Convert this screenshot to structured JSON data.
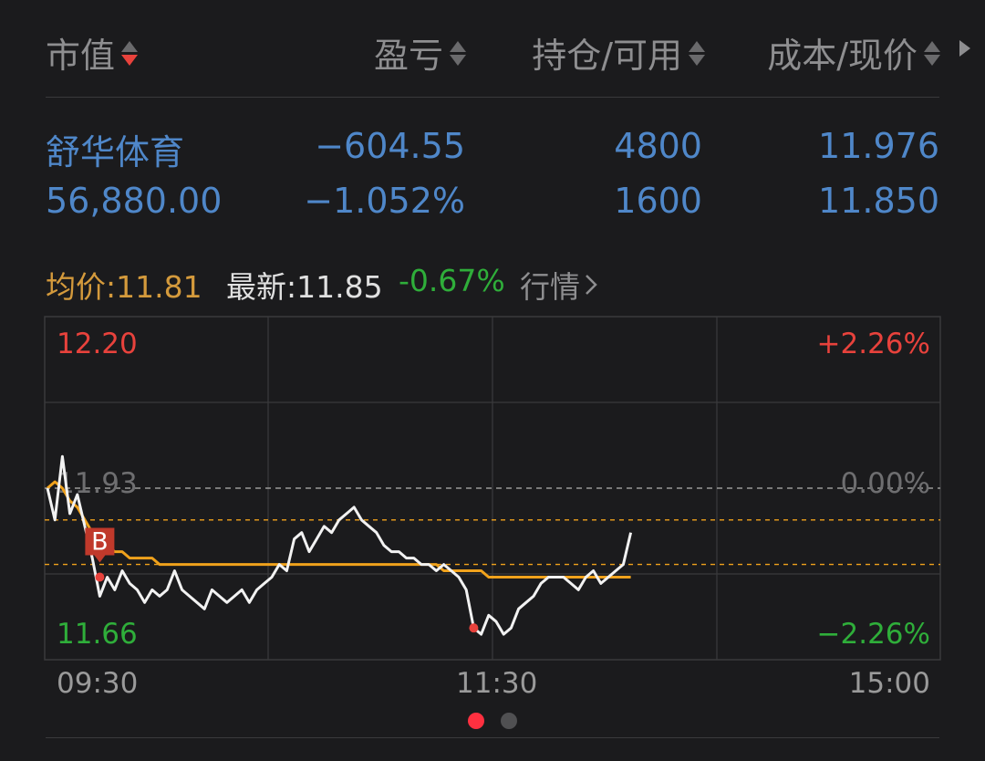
{
  "header": {
    "col1": "市值",
    "col2": "盈亏",
    "col3": "持仓/可用",
    "col4": "成本/现价"
  },
  "position": {
    "name": "舒华体育",
    "market_value": "56,880.00",
    "pnl": "−604.55",
    "pnl_pct": "−1.052%",
    "holding": "4800",
    "available": "1600",
    "cost": "11.976",
    "price": "11.850"
  },
  "quote": {
    "avg_label": "均价:",
    "avg_value": "11.81",
    "latest_label": "最新:",
    "latest_value": "11.85",
    "change_pct": "-0.67%",
    "detail_link": "行情"
  },
  "colors": {
    "blue": "#4f87c9",
    "red": "#e8423c",
    "green": "#2fae3a",
    "orange": "#f0a21c",
    "avg_label": "#d49a3c"
  },
  "chart_data": {
    "type": "line",
    "x_ticks": [
      "09:30",
      "11:30",
      "15:00"
    ],
    "ylim": [
      11.66,
      12.2
    ],
    "y_labels": {
      "top": "12.20",
      "mid": "11.93",
      "bottom": "11.66"
    },
    "pct_labels": {
      "top": "+2.26%",
      "mid": "0.00%",
      "bottom": "−2.26%"
    },
    "prev_close": 11.93,
    "reference_lines": [
      11.88,
      11.81
    ],
    "trade_marker": {
      "label": "B",
      "x_index": 7,
      "price": 11.81
    },
    "red_markers": [
      {
        "x_index": 7,
        "price": 11.79
      },
      {
        "x_index": 57,
        "price": 11.71
      }
    ],
    "series": [
      {
        "key": "price",
        "values": [
          11.93,
          11.88,
          11.98,
          11.89,
          11.92,
          11.87,
          11.82,
          11.76,
          11.79,
          11.77,
          11.8,
          11.78,
          11.77,
          11.75,
          11.77,
          11.76,
          11.77,
          11.8,
          11.77,
          11.76,
          11.75,
          11.74,
          11.77,
          11.76,
          11.75,
          11.76,
          11.77,
          11.75,
          11.77,
          11.78,
          11.79,
          11.81,
          11.8,
          11.85,
          11.86,
          11.83,
          11.85,
          11.87,
          11.86,
          11.88,
          11.89,
          11.9,
          11.88,
          11.87,
          11.86,
          11.84,
          11.83,
          11.83,
          11.82,
          11.82,
          11.81,
          11.81,
          11.8,
          11.81,
          11.8,
          11.79,
          11.77,
          11.71,
          11.7,
          11.73,
          11.72,
          11.7,
          11.71,
          11.74,
          11.75,
          11.76,
          11.78,
          11.79,
          11.79,
          11.79,
          11.78,
          11.77,
          11.79,
          11.8,
          11.78,
          11.79,
          11.8,
          11.81,
          11.86
        ]
      },
      {
        "key": "avg",
        "values": [
          11.93,
          11.94,
          11.93,
          11.91,
          11.9,
          11.88,
          11.86,
          11.85,
          11.84,
          11.83,
          11.83,
          11.82,
          11.82,
          11.82,
          11.82,
          11.81,
          11.81,
          11.81,
          11.81,
          11.81,
          11.81,
          11.81,
          11.81,
          11.81,
          11.81,
          11.81,
          11.81,
          11.81,
          11.81,
          11.81,
          11.81,
          11.81,
          11.81,
          11.81,
          11.81,
          11.81,
          11.81,
          11.81,
          11.81,
          11.81,
          11.81,
          11.81,
          11.81,
          11.81,
          11.81,
          11.81,
          11.81,
          11.81,
          11.81,
          11.81,
          11.81,
          11.81,
          11.81,
          11.8,
          11.8,
          11.8,
          11.8,
          11.8,
          11.8,
          11.79,
          11.79,
          11.79,
          11.79,
          11.79,
          11.79,
          11.79,
          11.79,
          11.79,
          11.79,
          11.79,
          11.79,
          11.79,
          11.79,
          11.79,
          11.79,
          11.79,
          11.79,
          11.79,
          11.79
        ]
      }
    ]
  },
  "pager": {
    "count": 2,
    "active": 0
  }
}
